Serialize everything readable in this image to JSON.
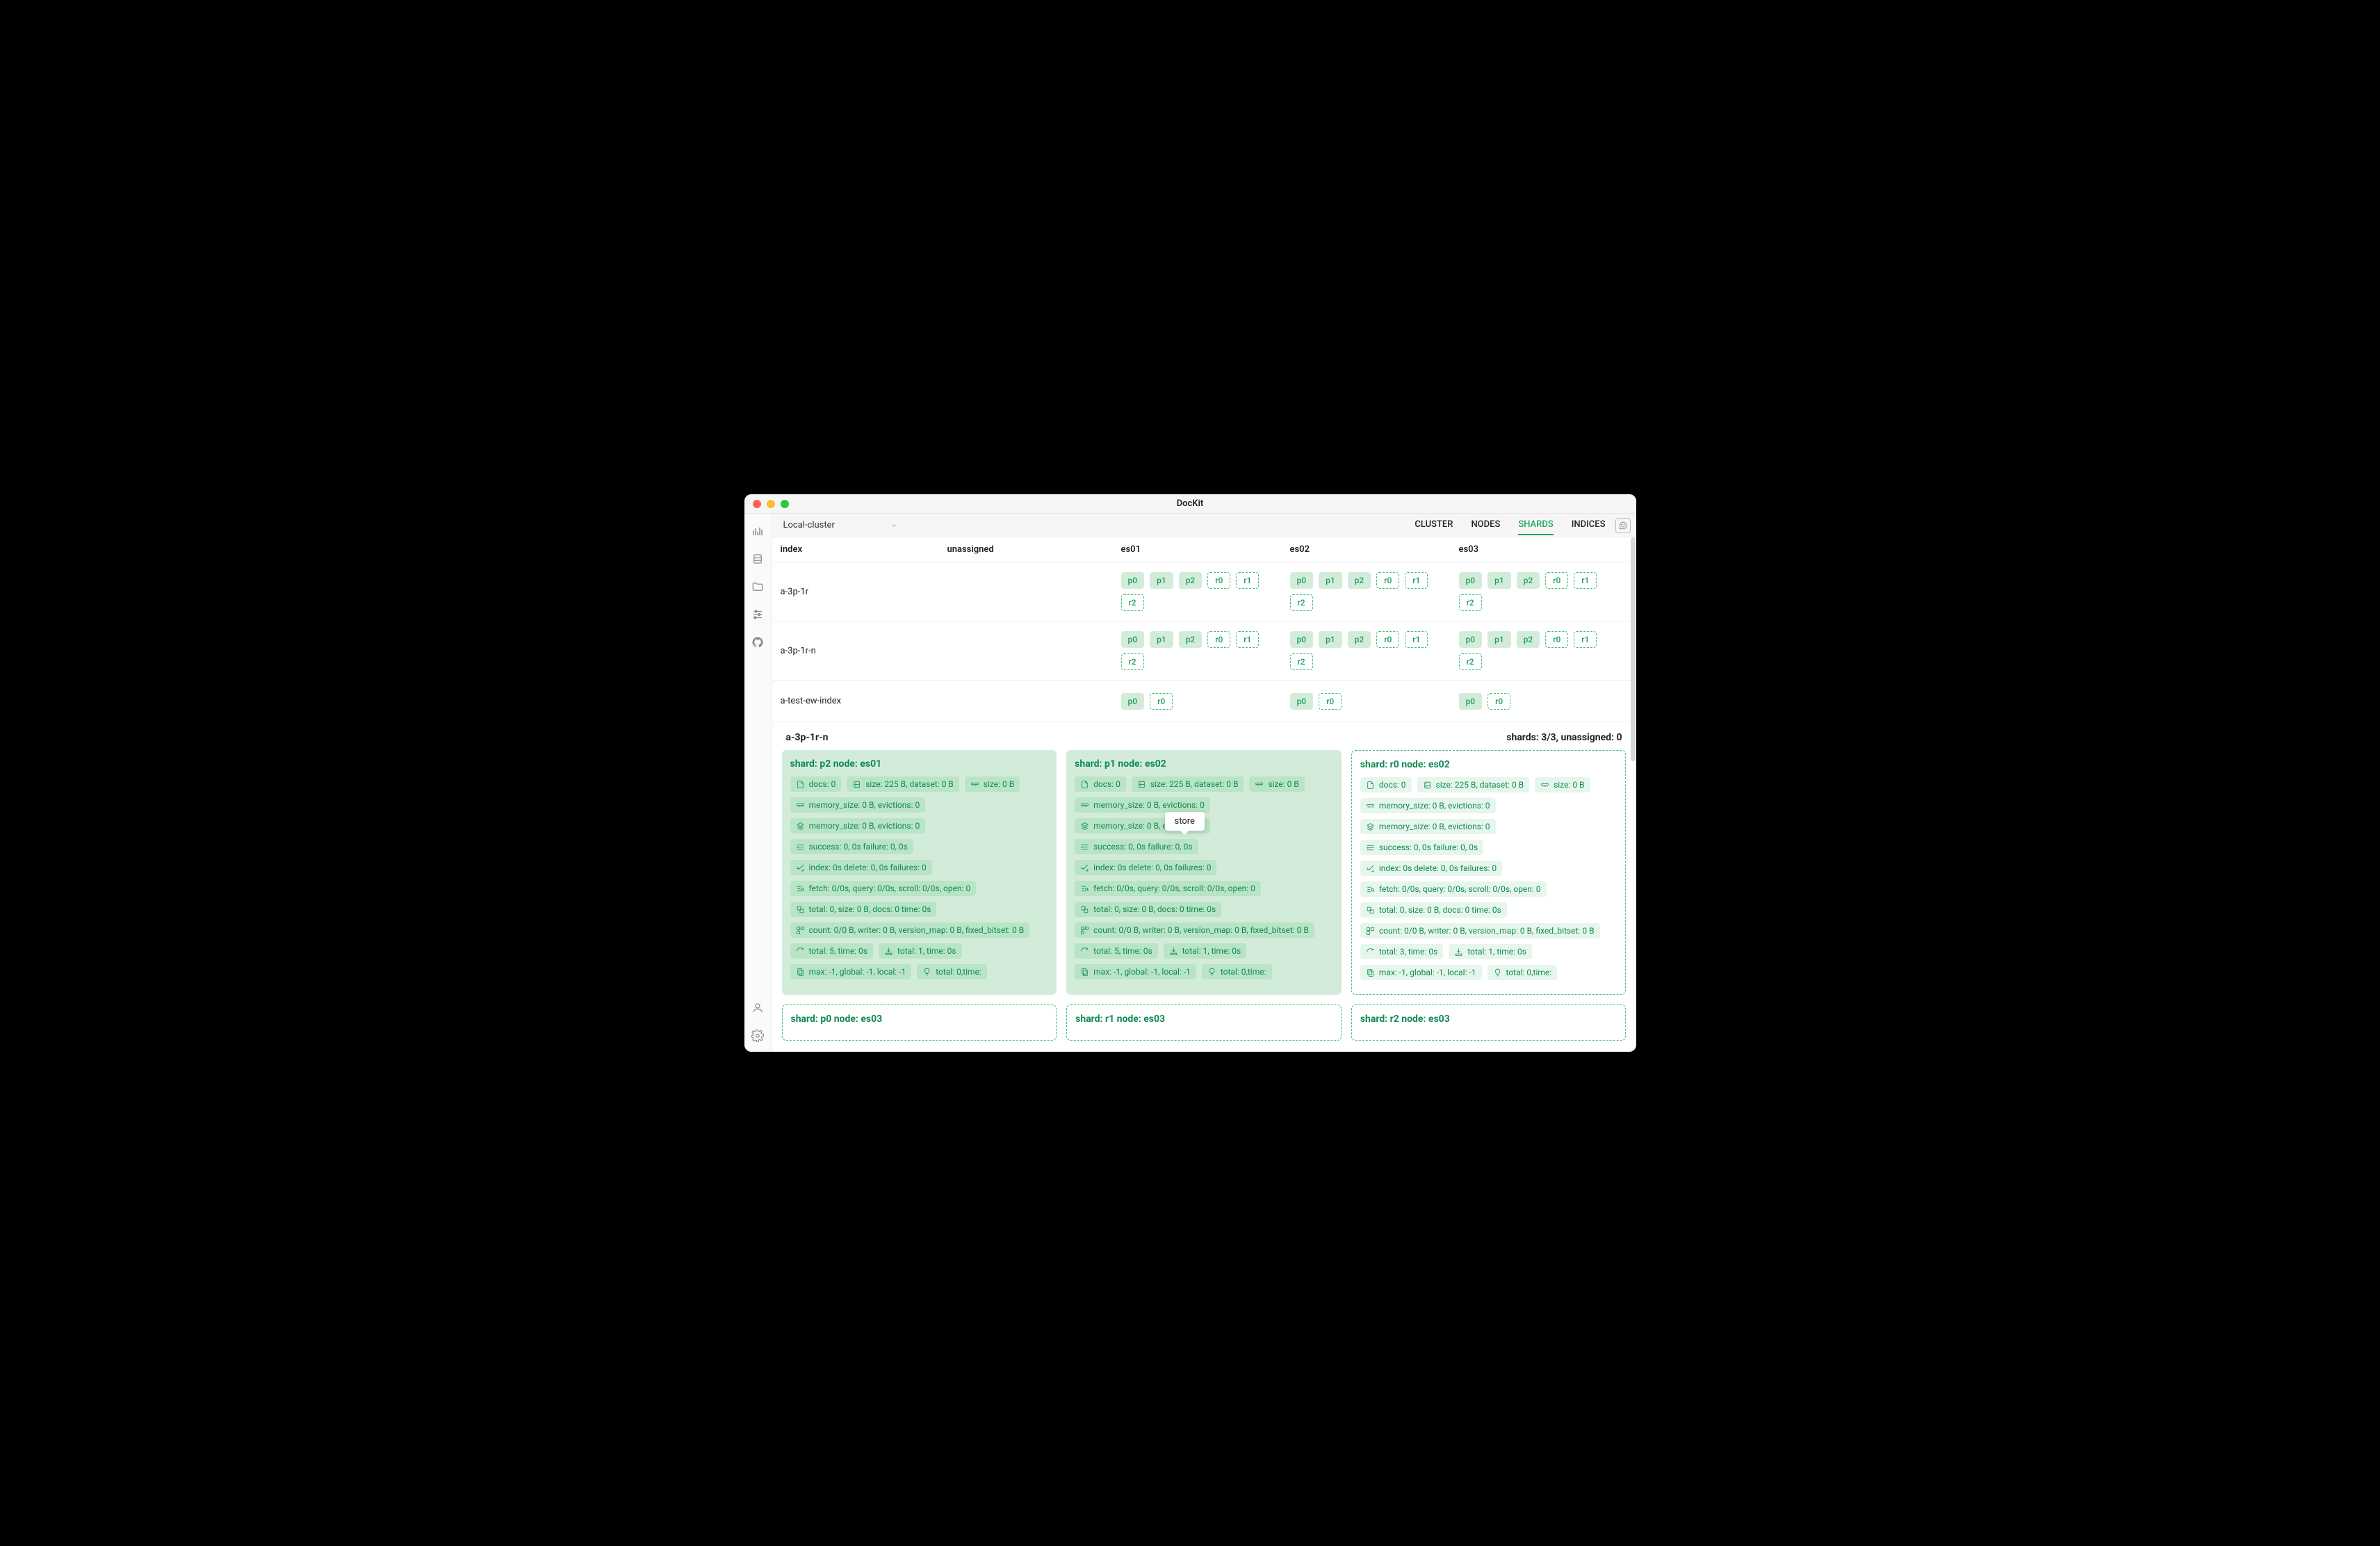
{
  "title": "DocKit",
  "topbar": {
    "cluster": "Local-cluster"
  },
  "tabs": {
    "cluster": "CLUSTER",
    "nodes": "NODES",
    "shards": "SHARDS",
    "indices": "INDICES",
    "active": "shards"
  },
  "table": {
    "columns": {
      "index": "index",
      "unassigned": "unassigned",
      "n1": "es01",
      "n2": "es02",
      "n3": "es03"
    },
    "rows": [
      {
        "index": "a-3p-1r",
        "es01": [
          [
            "p0",
            "p"
          ],
          [
            "p1",
            "p"
          ],
          [
            "p2",
            "p"
          ],
          [
            "r0",
            "r"
          ],
          [
            "r1",
            "r"
          ],
          [
            "r2",
            "r"
          ]
        ],
        "es02": [
          [
            "p0",
            "p"
          ],
          [
            "p1",
            "p"
          ],
          [
            "p2",
            "p"
          ],
          [
            "r0",
            "r"
          ],
          [
            "r1",
            "r"
          ],
          [
            "r2",
            "r"
          ]
        ],
        "es03": [
          [
            "p0",
            "p"
          ],
          [
            "p1",
            "p"
          ],
          [
            "p2",
            "p"
          ],
          [
            "r0",
            "r"
          ],
          [
            "r1",
            "r"
          ],
          [
            "r2",
            "r"
          ]
        ]
      },
      {
        "index": "a-3p-1r-n",
        "es01": [
          [
            "p0",
            "p"
          ],
          [
            "p1",
            "p"
          ],
          [
            "p2",
            "p"
          ],
          [
            "r0",
            "r"
          ],
          [
            "r1",
            "r"
          ],
          [
            "r2",
            "r"
          ]
        ],
        "es02": [
          [
            "p0",
            "p"
          ],
          [
            "p1",
            "p"
          ],
          [
            "p2",
            "p"
          ],
          [
            "r0",
            "r"
          ],
          [
            "r1",
            "r"
          ],
          [
            "r2",
            "r"
          ]
        ],
        "es03": [
          [
            "p0",
            "p"
          ],
          [
            "p1",
            "p"
          ],
          [
            "p2",
            "p"
          ],
          [
            "r0",
            "r"
          ],
          [
            "r1",
            "r"
          ],
          [
            "r2",
            "r"
          ]
        ]
      },
      {
        "index": "a-test-ew-index",
        "es01": [
          [
            "p0",
            "p"
          ],
          [
            "r0",
            "r"
          ]
        ],
        "es02": [
          [
            "p0",
            "p"
          ],
          [
            "r0",
            "r"
          ]
        ],
        "es03": [
          [
            "p0",
            "p"
          ],
          [
            "r0",
            "r"
          ]
        ]
      }
    ]
  },
  "detail": {
    "index": "a-3p-1r-n",
    "summary": "shards: 3/3, unassigned: 0",
    "tooltip": "store",
    "cards": [
      {
        "type": "primary",
        "title": "shard: p2 node: es01",
        "lines": [
          [
            [
              "doc",
              "docs: 0"
            ],
            [
              "store",
              "size: 225 B, dataset: 0 B"
            ],
            [
              "fielddata",
              "size: 0 B"
            ]
          ],
          [
            [
              "querycache",
              "memory_size: 0 B, evictions: 0"
            ]
          ],
          [
            [
              "reqcache",
              "memory_size: 0 B, evictions: 0"
            ]
          ],
          [
            [
              "flush",
              "success: 0, 0s failure: 0, 0s"
            ]
          ],
          [
            [
              "index",
              "index: 0s delete: 0, 0s failures: 0"
            ]
          ],
          [
            [
              "search",
              "fetch: 0/0s, query: 0/0s, scroll: 0/0s, open: 0"
            ]
          ],
          [
            [
              "merge",
              "total: 0, size: 0 B, docs: 0 time: 0s"
            ]
          ],
          [
            [
              "segments",
              "count: 0/0 B, writer: 0 B, version_map: 0 B, fixed_bitset: 0 B"
            ]
          ],
          [
            [
              "refresh",
              "total: 5, time: 0s"
            ],
            [
              "translog",
              "total: 1, time: 0s"
            ]
          ],
          [
            [
              "warmer",
              "max: -1, global: -1, local: -1"
            ],
            [
              "getstat",
              "total: 0,time:"
            ]
          ]
        ]
      },
      {
        "type": "primary",
        "title": "shard: p1 node: es02",
        "lines": [
          [
            [
              "doc",
              "docs: 0"
            ],
            [
              "store",
              "size: 225 B, dataset: 0 B"
            ],
            [
              "fielddata",
              "size: 0 B"
            ]
          ],
          [
            [
              "querycache",
              "memory_size: 0 B, evictions: 0"
            ]
          ],
          [
            [
              "reqcache",
              "memory_size: 0 B, evictions: 0"
            ]
          ],
          [
            [
              "flush",
              "success: 0, 0s failure: 0, 0s"
            ]
          ],
          [
            [
              "index",
              "index: 0s delete: 0, 0s failures: 0"
            ]
          ],
          [
            [
              "search",
              "fetch: 0/0s, query: 0/0s, scroll: 0/0s, open: 0"
            ]
          ],
          [
            [
              "merge",
              "total: 0, size: 0 B, docs: 0 time: 0s"
            ]
          ],
          [
            [
              "segments",
              "count: 0/0 B, writer: 0 B, version_map: 0 B, fixed_bitset: 0 B"
            ]
          ],
          [
            [
              "refresh",
              "total: 5, time: 0s"
            ],
            [
              "translog",
              "total: 1, time: 0s"
            ]
          ],
          [
            [
              "warmer",
              "max: -1, global: -1, local: -1"
            ],
            [
              "getstat",
              "total: 0,time:"
            ]
          ]
        ]
      },
      {
        "type": "replica",
        "title": "shard: r0 node: es02",
        "lines": [
          [
            [
              "doc",
              "docs: 0"
            ],
            [
              "store",
              "size: 225 B, dataset: 0 B"
            ],
            [
              "fielddata",
              "size: 0 B"
            ]
          ],
          [
            [
              "querycache",
              "memory_size: 0 B, evictions: 0"
            ]
          ],
          [
            [
              "reqcache",
              "memory_size: 0 B, evictions: 0"
            ]
          ],
          [
            [
              "flush",
              "success: 0, 0s failure: 0, 0s"
            ]
          ],
          [
            [
              "index",
              "index: 0s delete: 0, 0s failures: 0"
            ]
          ],
          [
            [
              "search",
              "fetch: 0/0s, query: 0/0s, scroll: 0/0s, open: 0"
            ]
          ],
          [
            [
              "merge",
              "total: 0, size: 0 B, docs: 0 time: 0s"
            ]
          ],
          [
            [
              "segments",
              "count: 0/0 B, writer: 0 B, version_map: 0 B, fixed_bitset: 0 B"
            ]
          ],
          [
            [
              "refresh",
              "total: 3, time: 0s"
            ],
            [
              "translog",
              "total: 1, time: 0s"
            ]
          ],
          [
            [
              "warmer",
              "max: -1, global: -1, local: -1"
            ],
            [
              "getstat",
              "total: 0,time:"
            ]
          ]
        ]
      },
      {
        "type": "replica",
        "title": "shard: p0 node: es03",
        "lines": []
      },
      {
        "type": "replica",
        "title": "shard: r1 node: es03",
        "lines": []
      },
      {
        "type": "replica",
        "title": "shard: r2 node: es03",
        "lines": []
      }
    ]
  }
}
